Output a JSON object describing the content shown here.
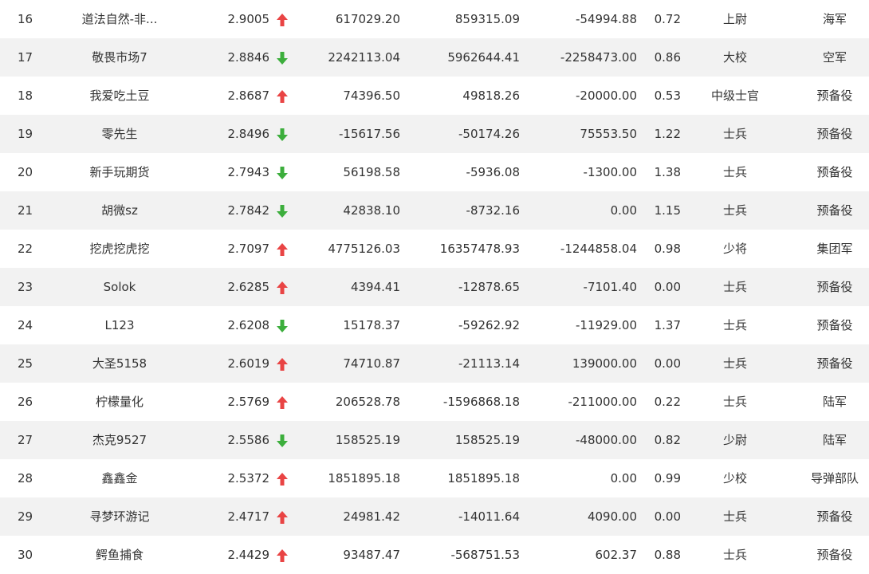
{
  "colors": {
    "up": "#e94444",
    "down": "#3cae3c",
    "row_alt": "#f2f2f2",
    "text": "#333333"
  },
  "rows": [
    {
      "rank": "16",
      "name": "道法自然-非...",
      "score": "2.9005",
      "trend": "up",
      "v1": "617029.20",
      "v2": "859315.09",
      "v3": "-54994.88",
      "ratio": "0.72",
      "military_rank": "上尉",
      "branch": "海军"
    },
    {
      "rank": "17",
      "name": "敬畏市场7",
      "score": "2.8846",
      "trend": "down",
      "v1": "2242113.04",
      "v2": "5962644.41",
      "v3": "-2258473.00",
      "ratio": "0.86",
      "military_rank": "大校",
      "branch": "空军"
    },
    {
      "rank": "18",
      "name": "我爱吃土豆",
      "score": "2.8687",
      "trend": "up",
      "v1": "74396.50",
      "v2": "49818.26",
      "v3": "-20000.00",
      "ratio": "0.53",
      "military_rank": "中级士官",
      "branch": "预备役"
    },
    {
      "rank": "19",
      "name": "零先生",
      "score": "2.8496",
      "trend": "down",
      "v1": "-15617.56",
      "v2": "-50174.26",
      "v3": "75553.50",
      "ratio": "1.22",
      "military_rank": "士兵",
      "branch": "预备役"
    },
    {
      "rank": "20",
      "name": "新手玩期货",
      "score": "2.7943",
      "trend": "down",
      "v1": "56198.58",
      "v2": "-5936.08",
      "v3": "-1300.00",
      "ratio": "1.38",
      "military_rank": "士兵",
      "branch": "预备役"
    },
    {
      "rank": "21",
      "name": "胡微sz",
      "score": "2.7842",
      "trend": "down",
      "v1": "42838.10",
      "v2": "-8732.16",
      "v3": "0.00",
      "ratio": "1.15",
      "military_rank": "士兵",
      "branch": "预备役"
    },
    {
      "rank": "22",
      "name": "挖虎挖虎挖",
      "score": "2.7097",
      "trend": "up",
      "v1": "4775126.03",
      "v2": "16357478.93",
      "v3": "-1244858.04",
      "ratio": "0.98",
      "military_rank": "少将",
      "branch": "集团军"
    },
    {
      "rank": "23",
      "name": "Solok",
      "score": "2.6285",
      "trend": "up",
      "v1": "4394.41",
      "v2": "-12878.65",
      "v3": "-7101.40",
      "ratio": "0.00",
      "military_rank": "士兵",
      "branch": "预备役"
    },
    {
      "rank": "24",
      "name": "L123",
      "score": "2.6208",
      "trend": "down",
      "v1": "15178.37",
      "v2": "-59262.92",
      "v3": "-11929.00",
      "ratio": "1.37",
      "military_rank": "士兵",
      "branch": "预备役"
    },
    {
      "rank": "25",
      "name": "大圣5158",
      "score": "2.6019",
      "trend": "up",
      "v1": "74710.87",
      "v2": "-21113.14",
      "v3": "139000.00",
      "ratio": "0.00",
      "military_rank": "士兵",
      "branch": "预备役"
    },
    {
      "rank": "26",
      "name": "柠檬量化",
      "score": "2.5769",
      "trend": "up",
      "v1": "206528.78",
      "v2": "-1596868.18",
      "v3": "-211000.00",
      "ratio": "0.22",
      "military_rank": "士兵",
      "branch": "陆军"
    },
    {
      "rank": "27",
      "name": "杰克9527",
      "score": "2.5586",
      "trend": "down",
      "v1": "158525.19",
      "v2": "158525.19",
      "v3": "-48000.00",
      "ratio": "0.82",
      "military_rank": "少尉",
      "branch": "陆军"
    },
    {
      "rank": "28",
      "name": "鑫鑫金",
      "score": "2.5372",
      "trend": "up",
      "v1": "1851895.18",
      "v2": "1851895.18",
      "v3": "0.00",
      "ratio": "0.99",
      "military_rank": "少校",
      "branch": "导弹部队"
    },
    {
      "rank": "29",
      "name": "寻梦环游记",
      "score": "2.4717",
      "trend": "up",
      "v1": "24981.42",
      "v2": "-14011.64",
      "v3": "4090.00",
      "ratio": "0.00",
      "military_rank": "士兵",
      "branch": "预备役"
    },
    {
      "rank": "30",
      "name": "鳄鱼捕食",
      "score": "2.4429",
      "trend": "up",
      "v1": "93487.47",
      "v2": "-568751.53",
      "v3": "602.37",
      "ratio": "0.88",
      "military_rank": "士兵",
      "branch": "预备役"
    }
  ]
}
